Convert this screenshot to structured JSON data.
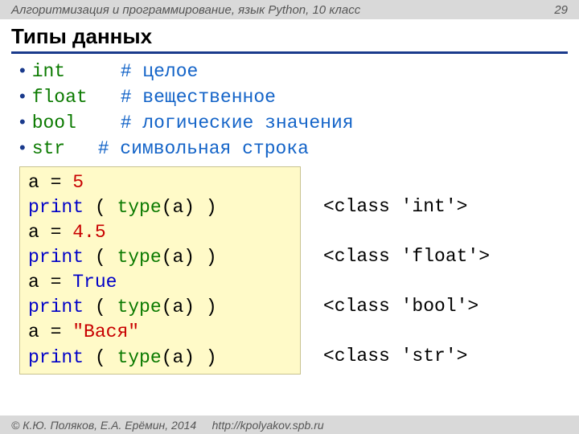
{
  "header": {
    "course": "Алгоритмизация и программирование, язык Python, 10 класс",
    "page": "29"
  },
  "title": "Типы данных",
  "bullets": [
    {
      "name": "int",
      "wclass": "w-int",
      "comment": "# целое"
    },
    {
      "name": "float",
      "wclass": "w-float",
      "comment": "# вещественное"
    },
    {
      "name": "bool",
      "wclass": "w-bool",
      "comment": "# логические значения"
    },
    {
      "name": "str",
      "wclass": "w-str",
      "comment": "# символьная строка"
    }
  ],
  "code": [
    {
      "assign_var": "a",
      "assign_op": " = ",
      "value": "5",
      "vclass": "lit-red"
    },
    {
      "print": true
    },
    {
      "assign_var": "a",
      "assign_op": " = ",
      "value": "4.5",
      "vclass": "lit-red"
    },
    {
      "print": true
    },
    {
      "assign_var": "a",
      "assign_op": " = ",
      "value": "True",
      "vclass": "kw-blue"
    },
    {
      "print": true
    },
    {
      "assign_var": "a",
      "assign_op": " = ",
      "value": "\"Вася\"",
      "vclass": "lit-red"
    },
    {
      "print": true
    }
  ],
  "print_parts": {
    "fn": "print",
    "open": " ( ",
    "type": "type",
    "arg": "(a) )"
  },
  "outputs": [
    "<class 'int'>",
    "<class 'float'>",
    "<class 'bool'>",
    "<class 'str'>"
  ],
  "footer": {
    "copy": "© К.Ю. Поляков, Е.А. Ерёмин, 2014",
    "url": "http://kpolyakov.spb.ru"
  }
}
